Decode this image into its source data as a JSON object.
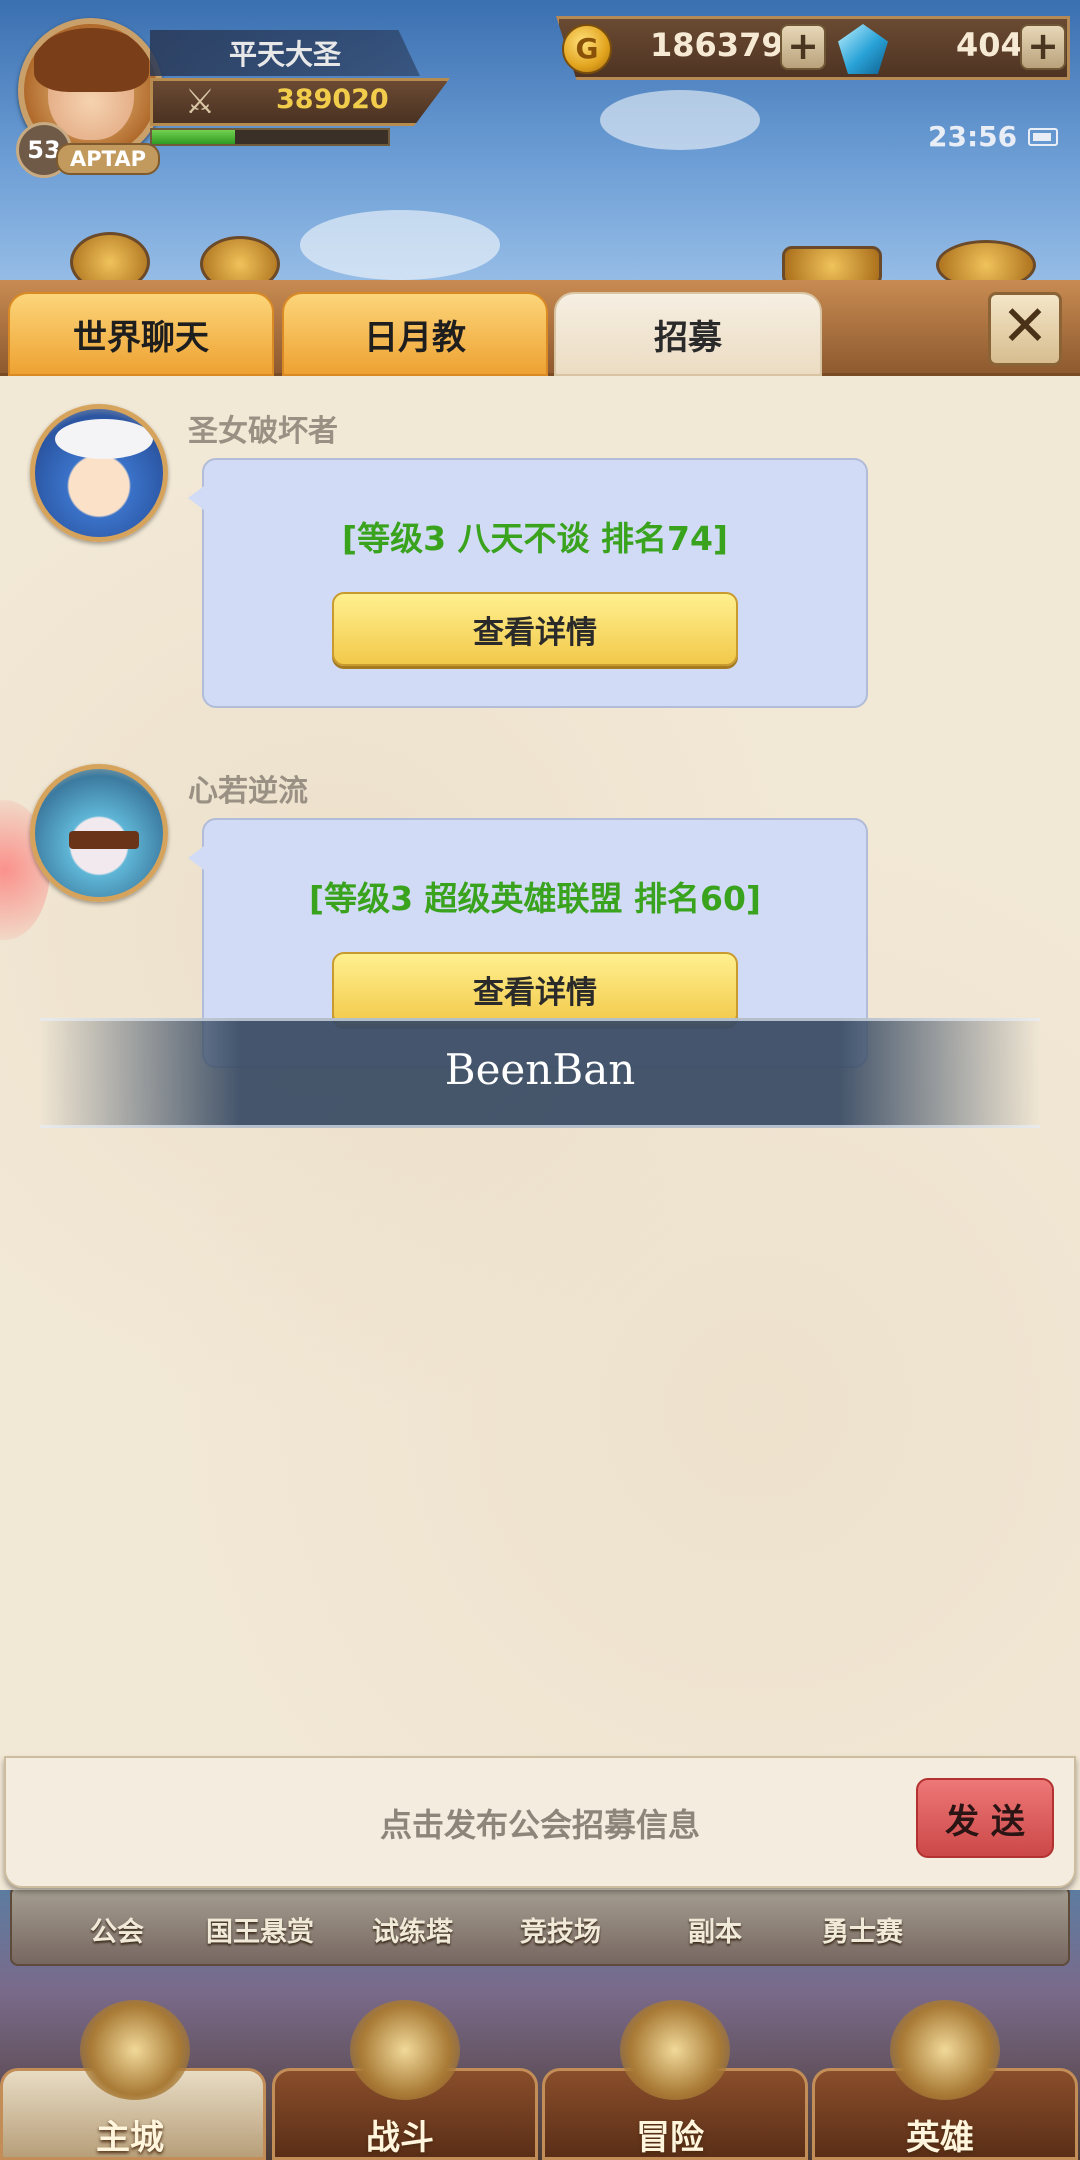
{
  "hud": {
    "player_name": "平天大圣",
    "power": "389020",
    "level": "53",
    "platform_tag": "APTAP",
    "gold": "186379",
    "gems": "404",
    "clock": "23:56",
    "exp_fraction": 0.35
  },
  "chat": {
    "tabs": [
      {
        "label": "世界聊天",
        "active": false
      },
      {
        "label": "日月教",
        "active": false
      },
      {
        "label": "招募",
        "active": true
      }
    ],
    "messages": [
      {
        "sender": "圣女破坏者",
        "text": "[等级3 八天不谈 排名74]",
        "button": "查看详情"
      },
      {
        "sender": "心若逆流",
        "text": "[等级3 超级英雄联盟 排名60]",
        "button": "查看详情"
      }
    ],
    "input_placeholder": "点击发布公会招募信息",
    "send_label": "发 送",
    "toast": "BeenBan"
  },
  "sub_nav": [
    "公会",
    "国王悬赏",
    "试练塔",
    "竞技场",
    "副本",
    "勇士赛"
  ],
  "main_tabs": [
    {
      "label": "主城",
      "active": true
    },
    {
      "label": "战斗",
      "active": false
    },
    {
      "label": "冒险",
      "active": false
    },
    {
      "label": "英雄",
      "active": false
    }
  ],
  "colors": {
    "tab_inactive": "#eea232",
    "bubble": "#d1dbf5",
    "guild_text": "#3aa31e",
    "send_button": "#cc4848"
  }
}
